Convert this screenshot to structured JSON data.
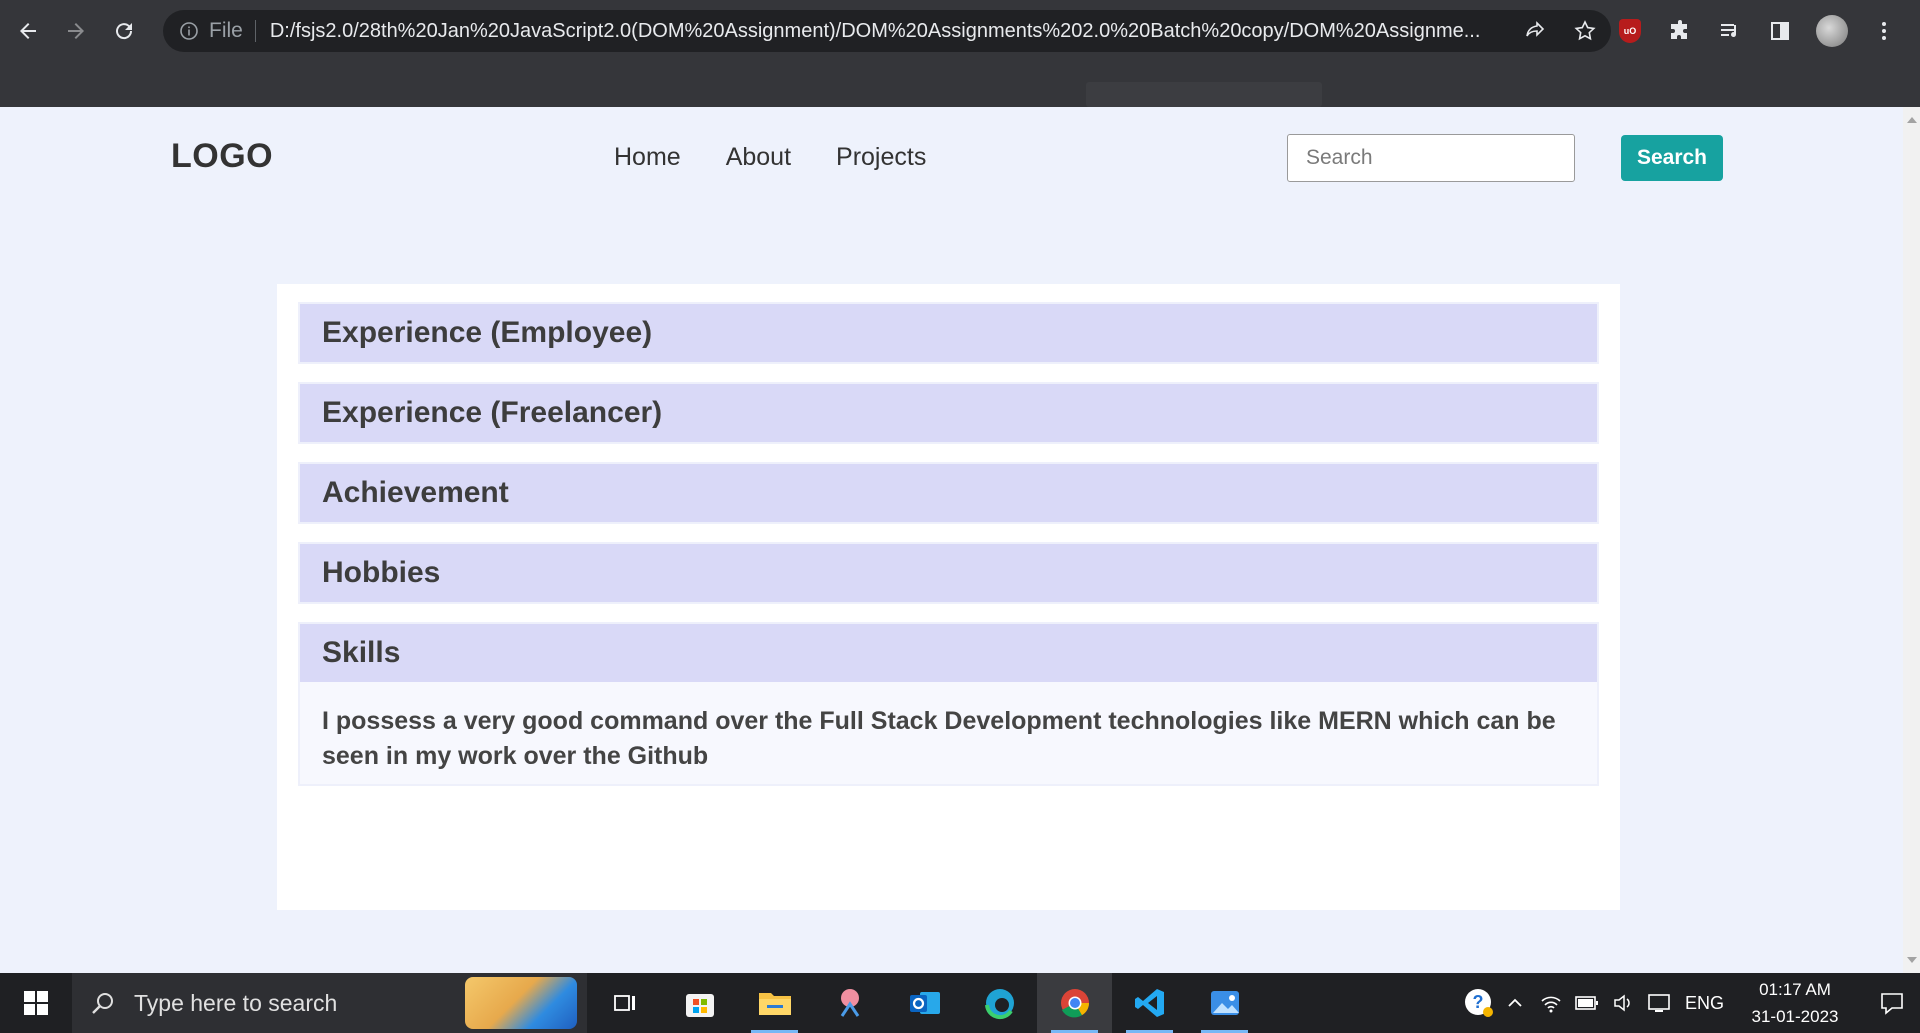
{
  "browser": {
    "url": "D:/fsjs2.0/28th%20Jan%20JavaScript2.0(DOM%20Assignment)/DOM%20Assignments%202.0%20Batch%20copy/DOM%20Assignme...",
    "site_info_label": "File",
    "extension_ublock_label": "uO"
  },
  "page": {
    "logo": "LOGO",
    "nav": [
      "Home",
      "About",
      "Projects"
    ],
    "search": {
      "placeholder": "Search",
      "button_label": "Search"
    },
    "accordion": [
      {
        "title": "Experience (Employee)",
        "expanded": false
      },
      {
        "title": "Experience (Freelancer)",
        "expanded": false
      },
      {
        "title": "Achievement",
        "expanded": false
      },
      {
        "title": "Hobbies",
        "expanded": false
      },
      {
        "title": "Skills",
        "expanded": true,
        "body": "I possess a very good command over the Full Stack Development technologies like MERN which can be seen in my work over the Github"
      }
    ]
  },
  "taskbar": {
    "search_placeholder": "Type here to search",
    "apps": [
      "task-view",
      "microsoft-store",
      "file-explorer",
      "snipping-tool",
      "outlook",
      "edge",
      "chrome",
      "vscode",
      "photos"
    ],
    "active_app": "chrome",
    "language": "ENG",
    "time": "01:17 AM",
    "date": "31-01-2023"
  },
  "colors": {
    "accent_button": "#17a2a0",
    "accordion_header": "#d9d9f7",
    "page_background": "#eef2fc"
  }
}
